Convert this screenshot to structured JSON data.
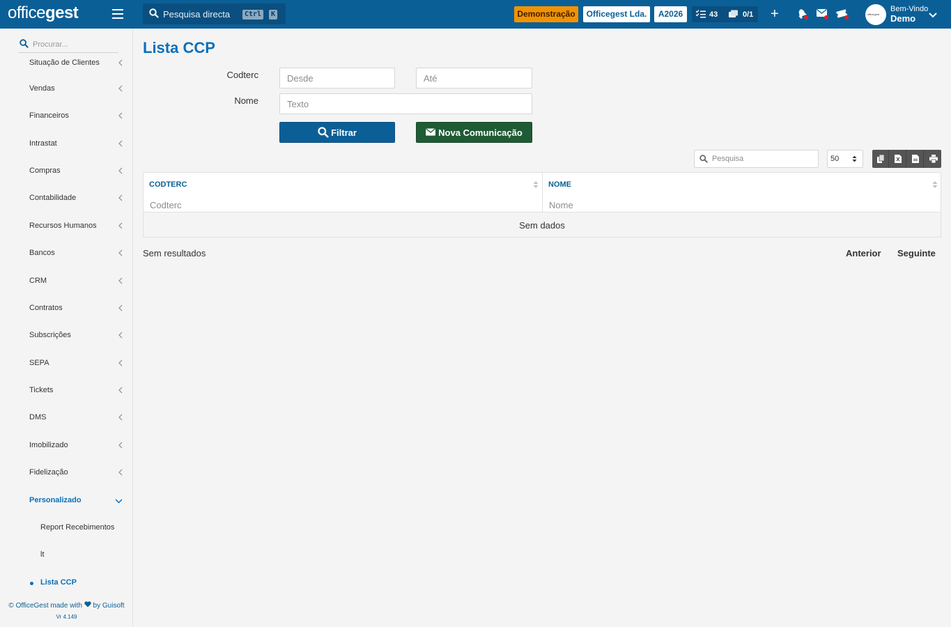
{
  "header": {
    "logo_prefix": "office",
    "logo_suffix": "gest",
    "search_label": "Pesquisa directa",
    "kbd_ctrl": "Ctrl",
    "kbd_k": "K",
    "demo_badge": "Demonstração",
    "company_badge": "Officegest Lda.",
    "year_badge": "A2026",
    "tasks_count": "43",
    "docs_count": "0/1",
    "welcome": "Bem-Vindo",
    "user": "Demo",
    "avatar_text": "officegest",
    "colors": {
      "bar": "#0b5f97",
      "demo": "#f39200",
      "notification": "#e02020"
    }
  },
  "sidebar": {
    "search_placeholder": "Procurar...",
    "items": [
      {
        "label": "Situação de Clientes",
        "chevron": "left"
      },
      {
        "label": "Vendas",
        "chevron": "left"
      },
      {
        "label": "Financeiros",
        "chevron": "left"
      },
      {
        "label": "Intrastat",
        "chevron": "left"
      },
      {
        "label": "Compras",
        "chevron": "left"
      },
      {
        "label": "Contabilidade",
        "chevron": "left"
      },
      {
        "label": "Recursos Humanos",
        "chevron": "left"
      },
      {
        "label": "Bancos",
        "chevron": "left"
      },
      {
        "label": "CRM",
        "chevron": "left"
      },
      {
        "label": "Contratos",
        "chevron": "left"
      },
      {
        "label": "Subscrições",
        "chevron": "left"
      },
      {
        "label": "SEPA",
        "chevron": "left"
      },
      {
        "label": "Tickets",
        "chevron": "left"
      },
      {
        "label": "DMS",
        "chevron": "left"
      },
      {
        "label": "Imobilizado",
        "chevron": "left"
      },
      {
        "label": "Fidelização",
        "chevron": "left"
      },
      {
        "label": "Personalizado",
        "chevron": "down",
        "active": true
      }
    ],
    "subitems": [
      {
        "label": "Report Recebimentos"
      },
      {
        "label": "lt"
      },
      {
        "label": "Lista CCP",
        "active": true
      }
    ],
    "footer_prefix": "© OfficeGest made with",
    "footer_suffix": "by Guisoft",
    "version": "Vr 4.149"
  },
  "main": {
    "title": "Lista CCP",
    "filters": {
      "codterc_label": "Codterc",
      "from_placeholder": "Desde",
      "to_placeholder": "Até",
      "name_label": "Nome",
      "name_placeholder": "Texto",
      "filter_button": "Filtrar",
      "communication_button": "Nova Comunicação"
    },
    "table": {
      "search_placeholder": "Pesquisa",
      "page_size": "50",
      "export_icons": [
        "copy-icon",
        "excel-icon",
        "pdf-icon",
        "print-icon"
      ],
      "columns": [
        {
          "header": "CODTERC",
          "filter_placeholder": "Codterc"
        },
        {
          "header": "NOME",
          "filter_placeholder": "Nome"
        }
      ],
      "empty_text": "Sem dados"
    },
    "results_text": "Sem resultados",
    "pager": {
      "previous": "Anterior",
      "next": "Seguinte"
    }
  }
}
